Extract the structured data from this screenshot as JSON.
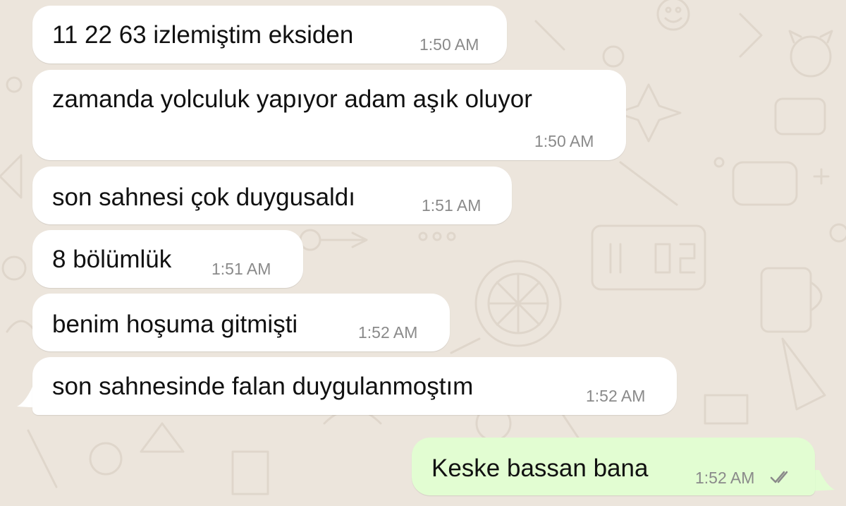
{
  "conversation": {
    "messages": [
      {
        "text": "11 22 63 izlemiştim eksiden",
        "time": "1:50 AM",
        "direction": "incoming"
      },
      {
        "text": "zamanda yolculuk yapıyor adam aşık oluyor",
        "time": "1:50 AM",
        "direction": "incoming"
      },
      {
        "text": "son sahnesi çok duygusaldı",
        "time": "1:51 AM",
        "direction": "incoming"
      },
      {
        "text": "8 bölümlük",
        "time": "1:51 AM",
        "direction": "incoming"
      },
      {
        "text": "benim hoşuma gitmişti",
        "time": "1:52 AM",
        "direction": "incoming"
      },
      {
        "text": "son sahnesinde falan duygulanmoştım",
        "time": "1:52 AM",
        "direction": "incoming"
      },
      {
        "text": "Keske bassan bana",
        "time": "1:52 AM",
        "direction": "outgoing",
        "status": "read"
      }
    ]
  },
  "icons": {
    "read_receipt": "double-check-icon",
    "incoming_tail": "bubble-tail-left-icon",
    "outgoing_tail": "bubble-tail-right-icon"
  },
  "colors": {
    "background": "#ece5dc",
    "incoming_bubble": "#ffffff",
    "outgoing_bubble": "#e2fdd2",
    "text": "#111111",
    "timestamp": "#8a8a8a",
    "read_ticks": "#8a8a8a"
  }
}
